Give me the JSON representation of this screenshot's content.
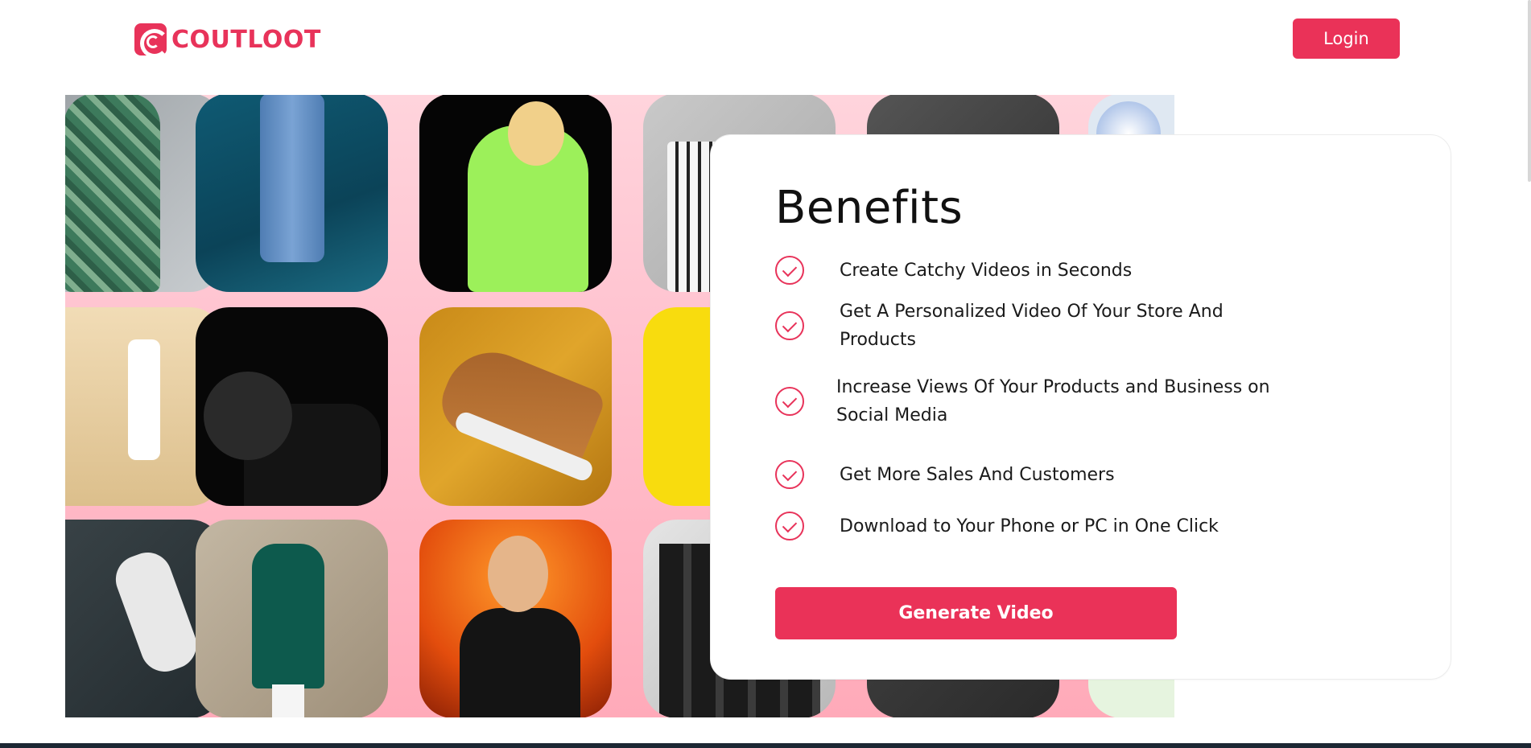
{
  "header": {
    "brand": "COUTLOOT",
    "login_label": "Login"
  },
  "benefits": {
    "title": "Benefits",
    "items": [
      "Create Catchy Videos in Seconds",
      "Get A Personalized Video Of Your Store And Products",
      "Increase Views Of Your Products and Business on Social Media",
      "Get More Sales And Customers",
      "Download to Your Phone or PC in One Click"
    ],
    "cta_label": "Generate Video"
  },
  "gallery": {
    "tiles": [
      "ethnic-dress",
      "jeans-model",
      "selfie-girl",
      "striped-top-hanger",
      "grey-shoe",
      "blue-round",
      "cosmetic-bottle",
      "camera-man",
      "sneaker",
      "yellow-backdrop",
      "dark-sneaker",
      "green-kurta",
      "man-with-camera-fire",
      "clothing-rack",
      "dark-shirt",
      "mint-item"
    ]
  },
  "colors": {
    "brand": "#e8335a",
    "button": "#ea3258",
    "gallery_bg": "#ffc2cf"
  }
}
